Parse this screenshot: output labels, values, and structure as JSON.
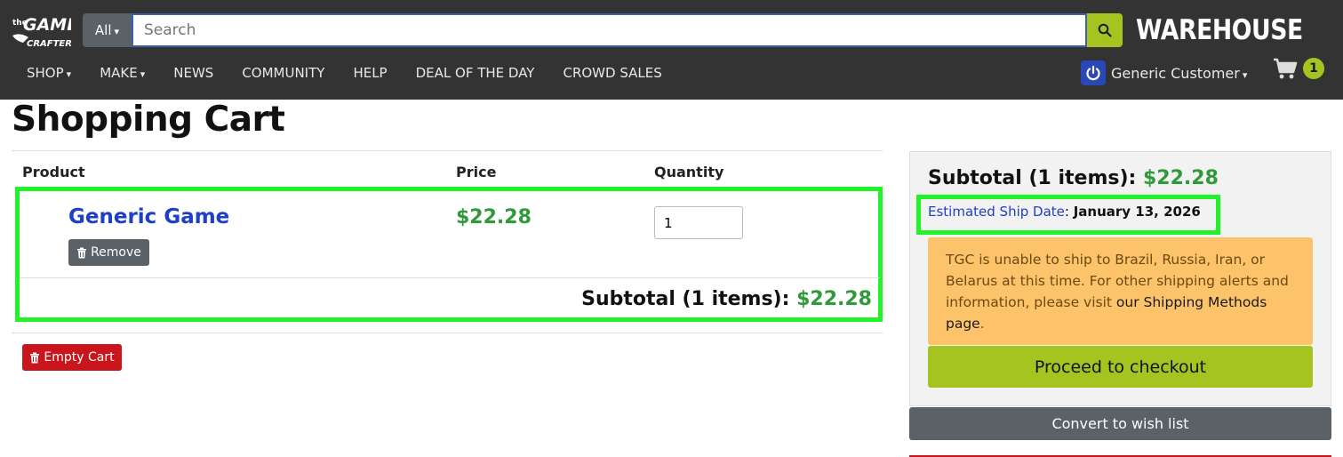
{
  "header": {
    "logo_text_the": "the",
    "logo_text_game": "GAME",
    "logo_text_crafter": "CRAFTER",
    "search": {
      "category": "All",
      "placeholder": "Search"
    },
    "warehouse_label": "WAREHOUSE",
    "nav": [
      {
        "label": "SHOP",
        "dropdown": true
      },
      {
        "label": "MAKE",
        "dropdown": true
      },
      {
        "label": "NEWS",
        "dropdown": false
      },
      {
        "label": "COMMUNITY",
        "dropdown": false
      },
      {
        "label": "HELP",
        "dropdown": false
      },
      {
        "label": "DEAL OF THE DAY",
        "dropdown": false
      },
      {
        "label": "CROWD SALES",
        "dropdown": false
      }
    ],
    "user_name": "Generic Customer",
    "cart_count": "1"
  },
  "page": {
    "title": "Shopping Cart",
    "columns": {
      "product": "Product",
      "price": "Price",
      "quantity": "Quantity"
    },
    "items": [
      {
        "name": "Generic Game",
        "price": "$22.28",
        "quantity": "1",
        "remove_label": "Remove"
      }
    ],
    "subtotal_label": "Subtotal (1 items):",
    "subtotal_value": "$22.28",
    "empty_cart_label": "Empty Cart"
  },
  "summary": {
    "subtotal_label": "Subtotal (1 items):",
    "subtotal_value": "$22.28",
    "ship_label": "Estimated Ship Date",
    "ship_date": "January 13, 2026",
    "alert_text": "TGC is unable to ship to Brazil, Russia, Iran, or Belarus at this time. For other shipping alerts and information, please visit ",
    "alert_link": "our Shipping Methods page",
    "checkout_label": "Proceed to checkout",
    "wishlist_label": "Convert to wish list"
  },
  "colors": {
    "header_bg": "#333333",
    "accent_green": "#a6c41f",
    "price_green": "#2f9a3a",
    "link_blue": "#1e3fc8",
    "danger_red": "#c9151b",
    "alert_bg": "#fcc36a",
    "highlight_box": "#22f22a"
  }
}
